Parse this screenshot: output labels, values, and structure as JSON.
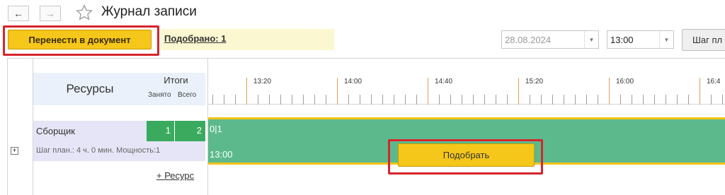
{
  "header": {
    "back_icon": "arrow-left-icon",
    "forward_icon": "arrow-right-icon",
    "star_icon": "star-outline-icon",
    "title": "Журнал записи"
  },
  "toolbar": {
    "transfer_label": "Перенести в документ",
    "selected_label": "Подобрано: 1",
    "date_value": "28.08.2024",
    "time_value": "13:00",
    "step_label": "Шаг пл"
  },
  "grid": {
    "resources_header": "Ресурсы",
    "totals_header": "Итоги",
    "occupied_label": "Занято",
    "total_label": "Всего",
    "time_ticks": [
      "13:20",
      "14:00",
      "14:40",
      "15:20",
      "16:00",
      "16:4"
    ],
    "resource": {
      "name": "Сборщик",
      "occupied": "1",
      "total": "2",
      "details": "Шаг план.: 4 ч. 0 мин. Мощность:1"
    },
    "add_resource_label": "+ Ресурс",
    "bar": {
      "count_text": "0|1",
      "start_time": "13:00",
      "pick_label": "Подобрать"
    }
  },
  "colors": {
    "accent_yellow": "#f6c71b",
    "highlight_red": "#d6252d",
    "busy_green": "#3aab5e",
    "timeline_green": "#5cb98c"
  }
}
